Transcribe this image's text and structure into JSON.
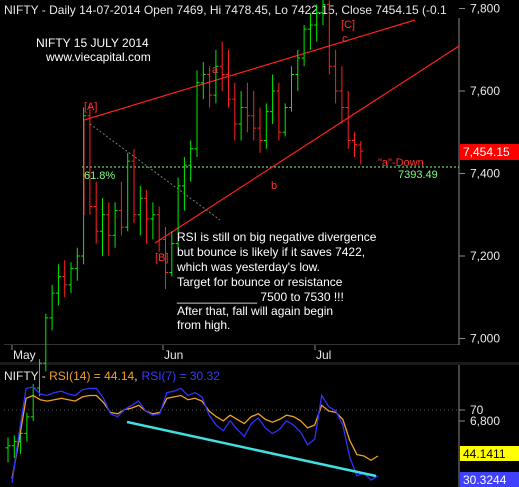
{
  "price_panel": {
    "header": "NIFTY - Daily 14-07-2014 Open 7469, Hi 7478.45, Lo 7422.15, Close 7454.15 (-0.1",
    "watermark_title": "NIFTY 15 JULY 2014",
    "watermark_site": "www.viecapital.com",
    "note_lines": [
      "RSI is still on big negative divergence",
      "but bounce is likely if it saves 7422,",
      "which was yesterday's low.",
      "Target for bounce or resistance",
      "____________ 7500 to 7530 !!!",
      "After that, fall will again begin",
      "from high."
    ],
    "last_price_label": "7,454.15",
    "fib_label": "61.8%",
    "fib_value_label": "7393.49",
    "wave_labels": {
      "A": "[A]",
      "B": "[B]",
      "C": "[C]",
      "a": "a",
      "b": "b",
      "c": "c",
      "down": "\"a\"-Down"
    },
    "colors": {
      "background": "#000000",
      "up_bar": "#00ee00",
      "down_bar": "#ff2020",
      "trendline": "#ff2020",
      "fib_line": "#7fff7f",
      "price_box": "#ff0000"
    }
  },
  "rsi_panel": {
    "prefix": "NIFTY - ",
    "rsi14_label": "RSI(14) = 44.14",
    "rsi7_sep": ",",
    "rsi7_label": "RSI(7) = 30.32",
    "rsi14_value_label": "44.1411",
    "rsi7_value_label": "30.3244",
    "level_label": "70",
    "colors": {
      "rsi14": "#f0a020",
      "rsi7": "#3030ff",
      "divergence_line": "#40e0e0",
      "rsi14_box": "#ffff00",
      "rsi7_box": "#4040ff"
    }
  },
  "chart_data": {
    "type": "ohlc",
    "title": "NIFTY - Daily 14-07-2014",
    "x_labels": [
      "May",
      "Jun",
      "Jul"
    ],
    "y_ticks": [
      6800,
      7000,
      7200,
      7400,
      7600,
      7800
    ],
    "y_tick_labels": [
      "6,800",
      "7,000",
      "7,200",
      "7,400",
      "7,600",
      "7,800"
    ],
    "ylim": [
      6660,
      7900
    ],
    "bars": [
      [
        6735,
        6760,
        6700,
        6740
      ],
      [
        6740,
        6765,
        6710,
        6750
      ],
      [
        6750,
        6780,
        6720,
        6770
      ],
      [
        6770,
        6820,
        6750,
        6810
      ],
      [
        6810,
        6890,
        6800,
        6880
      ],
      [
        6880,
        6950,
        6860,
        6940
      ],
      [
        6940,
        7060,
        6920,
        7050
      ],
      [
        7050,
        7130,
        7020,
        7110
      ],
      [
        7110,
        7180,
        7080,
        7150
      ],
      [
        7150,
        7190,
        7100,
        7130
      ],
      [
        7130,
        7185,
        7110,
        7170
      ],
      [
        7170,
        7220,
        7140,
        7200
      ],
      [
        7200,
        7560,
        7180,
        7540
      ],
      [
        7540,
        7570,
        7300,
        7320
      ],
      [
        7320,
        7380,
        7230,
        7260
      ],
      [
        7260,
        7340,
        7200,
        7300
      ],
      [
        7300,
        7330,
        7200,
        7250
      ],
      [
        7250,
        7330,
        7220,
        7310
      ],
      [
        7310,
        7380,
        7250,
        7270
      ],
      [
        7270,
        7450,
        7260,
        7430
      ],
      [
        7430,
        7460,
        7280,
        7300
      ],
      [
        7300,
        7370,
        7250,
        7340
      ],
      [
        7340,
        7360,
        7230,
        7290
      ],
      [
        7290,
        7330,
        7240,
        7300
      ],
      [
        7300,
        7320,
        7210,
        7240
      ],
      [
        7240,
        7270,
        7120,
        7160
      ],
      [
        7160,
        7260,
        7150,
        7230
      ],
      [
        7230,
        7390,
        7220,
        7370
      ],
      [
        7370,
        7440,
        7310,
        7420
      ],
      [
        7420,
        7480,
        7380,
        7460
      ],
      [
        7460,
        7650,
        7440,
        7620
      ],
      [
        7620,
        7670,
        7580,
        7640
      ],
      [
        7640,
        7660,
        7560,
        7590
      ],
      [
        7590,
        7700,
        7570,
        7660
      ],
      [
        7660,
        7720,
        7600,
        7640
      ],
      [
        7640,
        7700,
        7560,
        7580
      ],
      [
        7580,
        7620,
        7480,
        7520
      ],
      [
        7520,
        7600,
        7480,
        7560
      ],
      [
        7560,
        7620,
        7500,
        7540
      ],
      [
        7540,
        7600,
        7480,
        7510
      ],
      [
        7510,
        7560,
        7450,
        7480
      ],
      [
        7480,
        7570,
        7460,
        7550
      ],
      [
        7550,
        7640,
        7520,
        7600
      ],
      [
        7600,
        7620,
        7480,
        7500
      ],
      [
        7500,
        7570,
        7490,
        7560
      ],
      [
        7560,
        7660,
        7550,
        7640
      ],
      [
        7640,
        7700,
        7600,
        7680
      ],
      [
        7680,
        7760,
        7660,
        7750
      ],
      [
        7750,
        7790,
        7700,
        7760
      ],
      [
        7760,
        7810,
        7720,
        7790
      ],
      [
        7790,
        7830,
        7760,
        7810
      ],
      [
        7810,
        7820,
        7640,
        7660
      ],
      [
        7660,
        7700,
        7570,
        7600
      ],
      [
        7600,
        7660,
        7520,
        7560
      ],
      [
        7560,
        7600,
        7460,
        7480
      ],
      [
        7480,
        7500,
        7440,
        7470
      ],
      [
        7469,
        7478.45,
        7422.15,
        7454.15
      ]
    ],
    "series": [
      {
        "name": "RSI(14)",
        "values": [
          28,
          55,
          85,
          87,
          84,
          83,
          84,
          85,
          84,
          83,
          86,
          87,
          87,
          82,
          75,
          74,
          77,
          78,
          80,
          76,
          74,
          75,
          85,
          86,
          87,
          84,
          85,
          83,
          76,
          72,
          69,
          73,
          70,
          67,
          72,
          74,
          70,
          68,
          70,
          73,
          72,
          69,
          64,
          66,
          80,
          76,
          75,
          70,
          55,
          45,
          44,
          41,
          44
        ]
      },
      {
        "name": "RSI(7)",
        "values": [
          25,
          60,
          92,
          93,
          88,
          87,
          89,
          90,
          88,
          87,
          91,
          92,
          92,
          85,
          74,
          72,
          77,
          80,
          83,
          76,
          73,
          74,
          89,
          90,
          92,
          87,
          89,
          86,
          73,
          66,
          62,
          69,
          63,
          58,
          67,
          71,
          64,
          60,
          63,
          69,
          66,
          61,
          52,
          56,
          87,
          79,
          76,
          66,
          43,
          30,
          32,
          27,
          30
        ]
      }
    ],
    "rsi_ylim": [
      27,
      93
    ],
    "rsi_y_ticks": [
      70
    ]
  }
}
